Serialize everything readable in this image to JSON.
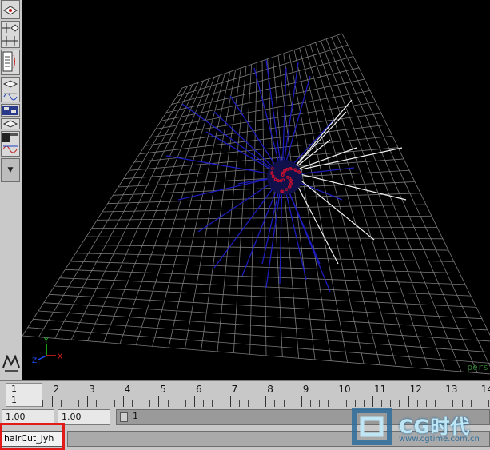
{
  "viewport": {
    "camera_label": "pers"
  },
  "axis_indicator": {
    "x": "X",
    "y": "Y",
    "z": "Z",
    "colors": {
      "x": "#e02020",
      "y": "#20d020",
      "z": "#2050ff"
    }
  },
  "scene": {
    "grid_color": "#7a7a7a",
    "hair_color_blue": "#1c1cc0",
    "hair_color_white": "#f0f0f0",
    "core_color": "#c01030"
  },
  "timeline": {
    "current_frame": "1",
    "current_frame_sub": "1",
    "ticks": [
      "1",
      "2",
      "3",
      "4",
      "5",
      "6",
      "7",
      "8",
      "9",
      "10",
      "11",
      "12",
      "13",
      "14"
    ]
  },
  "range": {
    "start_time": "1.00",
    "playback_start": "1.00",
    "range_value": "1"
  },
  "command_line": {
    "input_value": "hairCut_jyh"
  },
  "watermark": {
    "brand": "CG时代",
    "url": "www.cgtime.com.cn"
  },
  "shelf": {
    "icons": [
      "plane-icon",
      "snap-grid-icon",
      "attribute-icon",
      "curve-plane-icon",
      "graph-icon",
      "grid-icon",
      "render-icon",
      "dropdown-arrow-icon",
      "maya-logo-icon"
    ]
  }
}
